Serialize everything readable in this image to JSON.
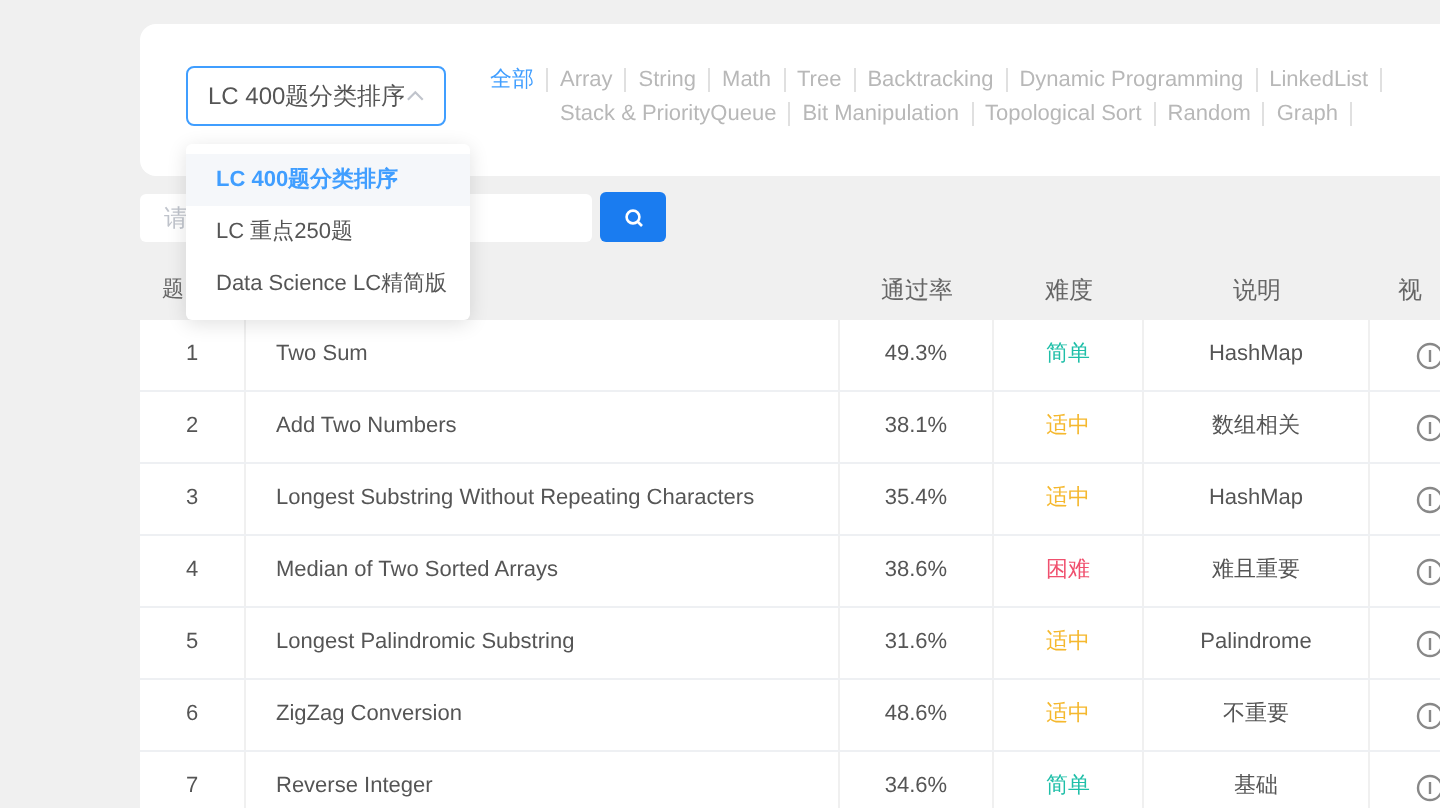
{
  "list_select": {
    "value": "LC 400题分类排序",
    "expanded": true
  },
  "category_tabs": {
    "first": {
      "label": "全部",
      "selected": true
    },
    "items": [
      {
        "label": "Array",
        "selected": false
      },
      {
        "label": "String",
        "selected": false
      },
      {
        "label": "Math",
        "selected": false
      },
      {
        "label": "Tree",
        "selected": false
      },
      {
        "label": "Backtracking",
        "selected": false
      },
      {
        "label": "Dynamic Programming",
        "selected": false
      },
      {
        "label": "LinkedList",
        "selected": false
      },
      {
        "label": "Stack & PriorityQueue",
        "selected": false
      },
      {
        "label": "Bit Manipulation",
        "selected": false
      },
      {
        "label": "Topological Sort",
        "selected": false
      },
      {
        "label": "Random",
        "selected": false
      },
      {
        "label": "Graph",
        "selected": false
      }
    ]
  },
  "dropdown": [
    {
      "label": "LC 400题分类排序",
      "selected": true
    },
    {
      "label": "LC 重点250题",
      "selected": false
    },
    {
      "label": "Data Science LC精简版",
      "selected": false
    }
  ],
  "search": {
    "placeholder": "请"
  },
  "table": {
    "columns": [
      "题",
      "",
      "通过率",
      "难度",
      "说明",
      "视"
    ],
    "rows": [
      {
        "no": "1",
        "title": "Two Sum",
        "rate": "49.3%",
        "difficulty": "简单",
        "color": "#1fbfa8",
        "note": "HashMap"
      },
      {
        "no": "2",
        "title": "Add Two Numbers",
        "rate": "38.1%",
        "difficulty": "适中",
        "color": "#f5b82e",
        "note": "数组相关"
      },
      {
        "no": "3",
        "title": "Longest Substring Without Repeating Characters",
        "rate": "35.4%",
        "difficulty": "适中",
        "color": "#f5b82e",
        "note": "HashMap"
      },
      {
        "no": "4",
        "title": "Median of Two Sorted Arrays",
        "rate": "38.6%",
        "difficulty": "困难",
        "color": "#f0506e",
        "note": "难且重要"
      },
      {
        "no": "5",
        "title": "Longest Palindromic Substring",
        "rate": "31.6%",
        "difficulty": "适中",
        "color": "#f5b82e",
        "note": "Palindrome"
      },
      {
        "no": "6",
        "title": "ZigZag Conversion",
        "rate": "48.6%",
        "difficulty": "适中",
        "color": "#f5b82e",
        "note": "不重要"
      },
      {
        "no": "7",
        "title": "Reverse Integer",
        "rate": "34.6%",
        "difficulty": "简单",
        "color": "#1fbfa8",
        "note": "基础"
      }
    ]
  }
}
